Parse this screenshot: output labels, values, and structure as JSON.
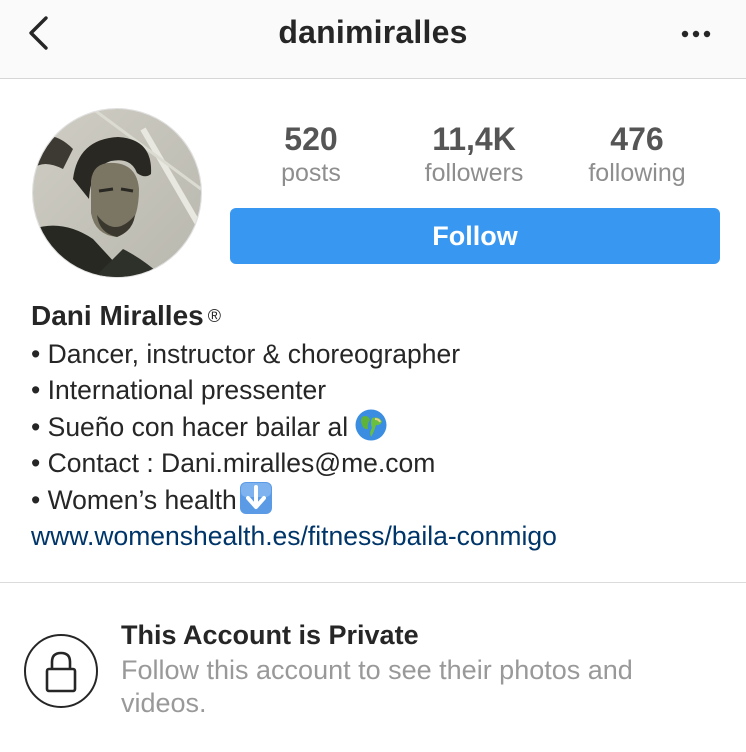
{
  "header": {
    "title": "danimiralles",
    "back_icon": "chevron-left-icon",
    "more_icon": "more-dots-icon"
  },
  "stats": [
    {
      "value": "520",
      "label": "posts"
    },
    {
      "value": "11,4K",
      "label": "followers"
    },
    {
      "value": "476",
      "label": "following"
    }
  ],
  "follow_button": {
    "label": "Follow",
    "color": "#3897f0"
  },
  "bio": {
    "name": "Dani Miralles",
    "name_mark": "®",
    "lines": [
      "• Dancer, instructor & choreographer",
      "• International pressenter",
      "• Sueño con hacer bailar al",
      "• Contact : Dani.miralles@me.com",
      "• Women’s health"
    ],
    "globe_emoji": "globe-emoji",
    "arrow_emoji": "down-arrow-emoji",
    "link": "www.womenshealth.es/fitness/baila-conmigo",
    "link_color": "#003569"
  },
  "private": {
    "icon": "lock-icon",
    "title": "This Account is Private",
    "description": "Follow this account to see their photos and videos."
  }
}
